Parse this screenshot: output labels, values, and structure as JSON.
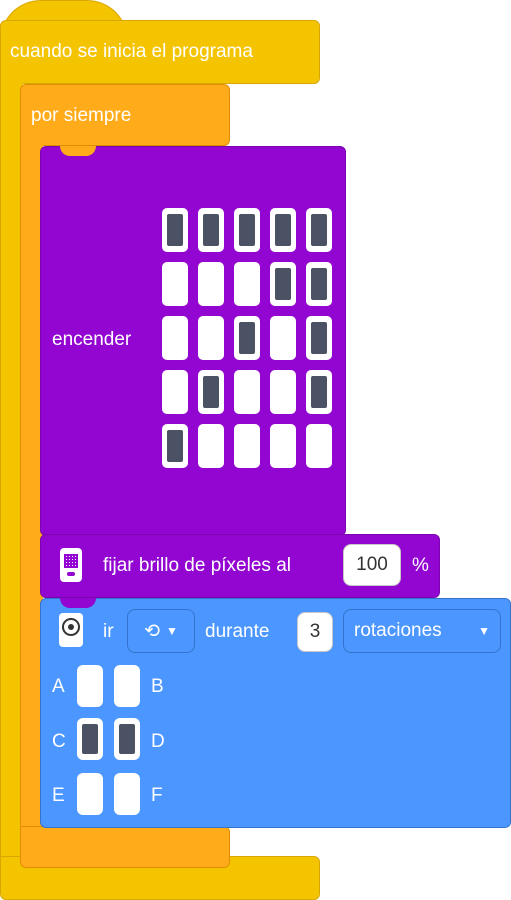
{
  "event": {
    "title": "cuando se inicia el programa"
  },
  "forever": {
    "label": "por siempre"
  },
  "matrix": {
    "label": "encender",
    "rows": [
      [
        1,
        1,
        1,
        1,
        1
      ],
      [
        0,
        0,
        0,
        1,
        1
      ],
      [
        0,
        0,
        1,
        0,
        1
      ],
      [
        0,
        1,
        0,
        0,
        1
      ],
      [
        1,
        0,
        0,
        0,
        0
      ]
    ]
  },
  "brightness": {
    "label": "fijar brillo de píxeles al",
    "value": "100",
    "unit": "%"
  },
  "motor": {
    "go_label": "ir",
    "direction_glyph": "⟲",
    "during_label": "durante",
    "amount": "3",
    "unit_option": "rotaciones",
    "ports": [
      {
        "left": "A",
        "right": "B",
        "left_on": false,
        "right_on": false
      },
      {
        "left": "C",
        "right": "D",
        "left_on": true,
        "right_on": true
      },
      {
        "left": "E",
        "right": "F",
        "left_on": false,
        "right_on": false
      }
    ]
  },
  "colors": {
    "event": "#f5c400",
    "control": "#ffab1a",
    "display": "#9305d1",
    "motor": "#4c97ff",
    "pixel_on": "#4b5263"
  }
}
